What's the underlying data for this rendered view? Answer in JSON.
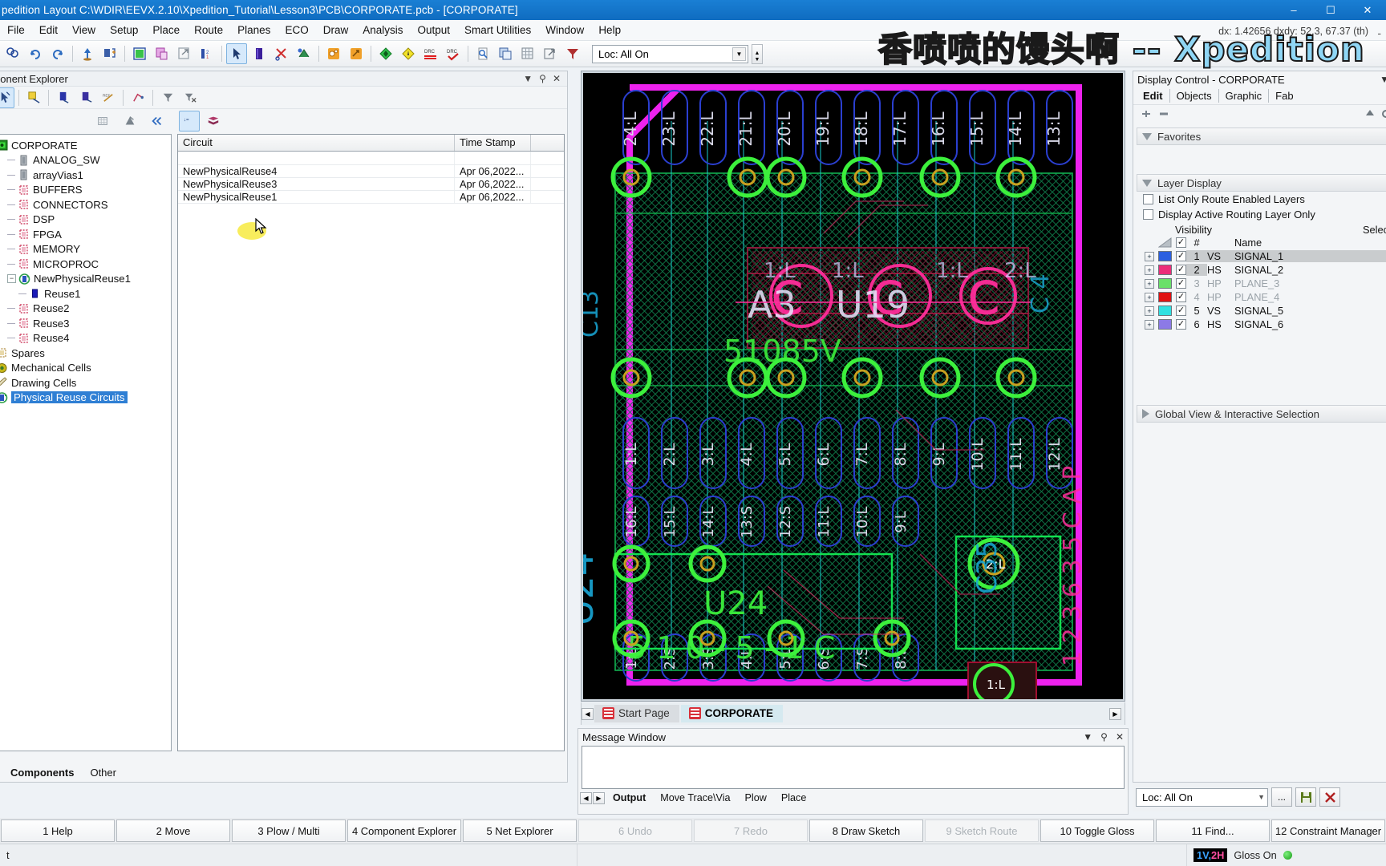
{
  "window": {
    "title": "pedition Layout  C:\\WDIR\\EEVX.2.10\\Xpedition_Tutorial\\Lesson3\\PCB\\CORPORATE.pcb - [CORPORATE]",
    "minimize": "–",
    "maximize": "☐",
    "close": "✕",
    "inner_minimize": "-"
  },
  "watermark": "香喷喷的馒头啊 -- Xpedition",
  "menu": {
    "items": [
      "File",
      "Edit",
      "View",
      "Setup",
      "Place",
      "Route",
      "Planes",
      "ECO",
      "Draw",
      "Analysis",
      "Output",
      "Smart Utilities",
      "Window",
      "Help"
    ]
  },
  "toolbar": {
    "loc_value": "Loc: All On",
    "icons": [
      "find-icon",
      "undo-icon",
      "redo-icon",
      "up-arrow-icon",
      "place-parts-icon",
      "board-outline-icon",
      "copy-paste-icon",
      "export-icon",
      "layers-2-icon",
      "select-arrow-icon",
      "trace-icon",
      "scissors-icon",
      "plow-icon",
      "reuse-orange-icon",
      "reuse-orange2-icon",
      "green-diamond-icon",
      "yellow-diamond-icon",
      "drc-icon",
      "drc-check-icon",
      "zoom-page-icon",
      "copy-layers-icon",
      "grid-icon",
      "extract-icon",
      "filter-icon"
    ]
  },
  "coordinate_readout": "dx: 1.42656  dxdy: 52.3, 67.37  (th)",
  "component_explorer": {
    "caption": "ponent Explorer",
    "caption_buttons": [
      "chevron-down-icon",
      "pin-icon",
      "close-icon"
    ],
    "toolbar_icons": [
      "select-icon",
      "cross-probe-icon",
      "part-blue-icon",
      "part-dark-icon",
      "ref-des-icon",
      "net-icon",
      "filter-icon",
      "filter-clear-icon"
    ],
    "tree_tools": [
      "grid-view-icon",
      "scatter-icon",
      "collapse-icon"
    ],
    "tree": [
      {
        "label": "CORPORATE",
        "depth": 0,
        "icon": "board-green-icon",
        "expander": false,
        "selected": false
      },
      {
        "label": "ANALOG_SW",
        "depth": 1,
        "icon": "part-grey-icon",
        "expander": false,
        "selected": false
      },
      {
        "label": "arrayVias1",
        "depth": 1,
        "icon": "part-grey-icon",
        "expander": false,
        "selected": false
      },
      {
        "label": "BUFFERS",
        "depth": 1,
        "icon": "cluster-red-icon",
        "expander": false,
        "selected": false
      },
      {
        "label": "CONNECTORS",
        "depth": 1,
        "icon": "cluster-red-icon",
        "expander": false,
        "selected": false
      },
      {
        "label": "DSP",
        "depth": 1,
        "icon": "cluster-red-icon",
        "expander": false,
        "selected": false
      },
      {
        "label": "FPGA",
        "depth": 1,
        "icon": "cluster-red-icon",
        "expander": false,
        "selected": false
      },
      {
        "label": "MEMORY",
        "depth": 1,
        "icon": "cluster-red-icon",
        "expander": false,
        "selected": false
      },
      {
        "label": "MICROPROC",
        "depth": 1,
        "icon": "cluster-red-icon",
        "expander": false,
        "selected": false
      },
      {
        "label": "NewPhysicalReuse1",
        "depth": 1,
        "icon": "reuse-green-icon",
        "expander": true,
        "selected": false
      },
      {
        "label": "Reuse1",
        "depth": 2,
        "icon": "part-blue-icon",
        "expander": false,
        "selected": false
      },
      {
        "label": "Reuse2",
        "depth": 1,
        "icon": "cluster-red-icon",
        "expander": false,
        "selected": false
      },
      {
        "label": "Reuse3",
        "depth": 1,
        "icon": "cluster-red-icon",
        "expander": false,
        "selected": false
      },
      {
        "label": "Reuse4",
        "depth": 1,
        "icon": "cluster-red-icon",
        "expander": false,
        "selected": false
      },
      {
        "label": "Spares",
        "depth": 0,
        "icon": "spares-icon",
        "expander": false,
        "selected": false
      },
      {
        "label": "Mechanical Cells",
        "depth": 0,
        "icon": "gear-yellow-icon",
        "expander": false,
        "selected": false
      },
      {
        "label": "Drawing Cells",
        "depth": 0,
        "icon": "pencil-icon",
        "expander": false,
        "selected": false
      },
      {
        "label": "Physical Reuse Circuits",
        "depth": 0,
        "icon": "reuse-green-icon",
        "expander": false,
        "selected": true
      }
    ],
    "grid": {
      "columns": [
        "Circuit",
        "Time Stamp"
      ],
      "rows": [
        {
          "circuit": "NewPhysicalReuse4",
          "time_stamp": "Apr 06,2022..."
        },
        {
          "circuit": "NewPhysicalReuse3",
          "time_stamp": "Apr 06,2022..."
        },
        {
          "circuit": "NewPhysicalReuse1",
          "time_stamp": "Apr 06,2022..."
        }
      ]
    },
    "bottom_tabs": [
      {
        "label": "Components",
        "active": true
      },
      {
        "label": "Other",
        "active": false
      }
    ]
  },
  "document_tabs": [
    {
      "label": "Start Page",
      "active": false
    },
    {
      "label": "CORPORATE",
      "active": true
    }
  ],
  "message_window": {
    "caption": "Message Window",
    "caption_buttons": [
      "chevron-down-icon",
      "pin-icon",
      "close-icon"
    ],
    "content": "",
    "tabs": [
      {
        "label": "Output",
        "active": true
      },
      {
        "label": "Move Trace\\Via",
        "active": false
      },
      {
        "label": "Plow",
        "active": false
      },
      {
        "label": "Place",
        "active": false
      }
    ]
  },
  "display_control": {
    "caption": "Display Control - CORPORATE",
    "caption_buttons": [
      "chevron-down-icon",
      "pin-icon"
    ],
    "tabs": [
      {
        "label": "Edit",
        "active": true
      },
      {
        "label": "Objects",
        "active": false
      },
      {
        "label": "Graphic",
        "active": false
      },
      {
        "label": "Fab",
        "active": false
      }
    ],
    "small_tools": [
      "add-icon",
      "remove-icon"
    ],
    "favorites": {
      "label": "Favorites",
      "expanded": true
    },
    "layer_display": {
      "label": "Layer Display",
      "expanded": true,
      "checkboxes": [
        {
          "label": "List Only Route Enabled Layers",
          "checked": false
        },
        {
          "label": "Display Active Routing Layer Only",
          "checked": false
        }
      ],
      "header": {
        "visibility": "Visibility",
        "num": "#",
        "name": "Name",
        "selectable": "Selec"
      },
      "header_checked": true,
      "layers": [
        {
          "num": "1",
          "type": "VS",
          "name": "SIGNAL_1",
          "color": "#2b5fe0",
          "checked": true,
          "dim": false,
          "row_highlight": true,
          "num_highlight": true
        },
        {
          "num": "2",
          "type": "HS",
          "name": "SIGNAL_2",
          "color": "#ec2d7a",
          "checked": true,
          "dim": false,
          "row_highlight": false,
          "num_highlight": true
        },
        {
          "num": "3",
          "type": "HP",
          "name": "PLANE_3",
          "color": "#6ae06a",
          "checked": true,
          "dim": true,
          "row_highlight": false,
          "num_highlight": false
        },
        {
          "num": "4",
          "type": "HP",
          "name": "PLANE_4",
          "color": "#e01212",
          "checked": true,
          "dim": true,
          "row_highlight": false,
          "num_highlight": false
        },
        {
          "num": "5",
          "type": "VS",
          "name": "SIGNAL_5",
          "color": "#30e0e0",
          "checked": true,
          "dim": false,
          "row_highlight": false,
          "num_highlight": false
        },
        {
          "num": "6",
          "type": "HS",
          "name": "SIGNAL_6",
          "color": "#8c7ae6",
          "checked": true,
          "dim": false,
          "row_highlight": false,
          "num_highlight": false
        }
      ]
    },
    "global_view": {
      "label": "Global View & Interactive Selection",
      "expanded": false
    },
    "bottom_loc": {
      "value": "Loc: All On",
      "ellipsis_button": "...",
      "save_button": "save-icon",
      "delete_button": "✕"
    }
  },
  "function_keys": [
    {
      "label": "1 Help",
      "disabled": false
    },
    {
      "label": "2 Move",
      "disabled": false
    },
    {
      "label": "3 Plow / Multi",
      "disabled": false
    },
    {
      "label": "4 Component Explorer",
      "disabled": false
    },
    {
      "label": "5 Net Explorer",
      "disabled": false
    },
    {
      "label": "6 Undo",
      "disabled": true
    },
    {
      "label": "7 Redo",
      "disabled": true
    },
    {
      "label": "8 Draw Sketch",
      "disabled": false
    },
    {
      "label": "9 Sketch Route",
      "disabled": true
    },
    {
      "label": "10 Toggle Gloss",
      "disabled": false
    },
    {
      "label": "11 Find...",
      "disabled": false
    },
    {
      "label": "12 Constraint Manager",
      "disabled": false
    }
  ],
  "status_bar": {
    "left_text": "t",
    "layer_indicator_v": "1V,",
    "layer_indicator_h": "2H",
    "gloss": "Gloss On"
  },
  "pcb": {
    "background": "#000000",
    "outline_color": "#e621e6",
    "plane_color": "#12a012",
    "silk_color": "#20d0d0",
    "pin_color": "#2b3fd0",
    "pad_green": "#3cf03c",
    "pink": "#ff2d9b",
    "ref_designators": [
      "U24",
      "C35",
      "C13"
    ],
    "top_pin_labels": [
      "24:L",
      "23:L",
      "22:L",
      "21:L",
      "20:L",
      "19:L",
      "18:L",
      "17:L",
      "16:L",
      "15:L",
      "14:L",
      "13:L"
    ],
    "mid_pin_labels": [
      "1:L",
      "2:L",
      "3:L",
      "4:L",
      "5:L",
      "6:L",
      "7:L",
      "8:L",
      "9:L",
      "10:L",
      "11:L",
      "12:L"
    ],
    "low_pin_labels": [
      "16:L",
      "15:L",
      "14:L",
      "13:S",
      "12:S",
      "11:L",
      "10:L",
      "9:L"
    ],
    "bot_pin_labels": [
      "1:L",
      "2:S",
      "3:S",
      "4:L",
      "5:L",
      "6:S",
      "7:S",
      "8:L"
    ],
    "silk_texts": [
      "U24",
      "C35",
      "51085V",
      "5 1 0 - 5 - 1 C",
      "1:L",
      "2:L"
    ],
    "side_text": "1 2 3 6 3 5 C A P"
  }
}
